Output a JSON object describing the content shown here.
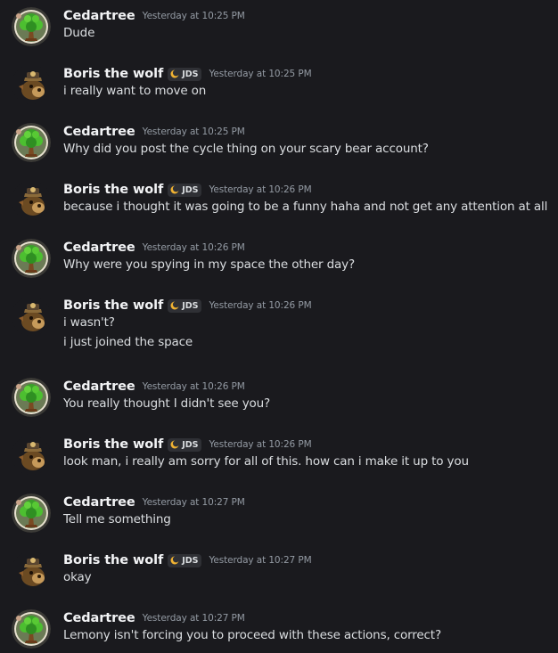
{
  "messages": [
    {
      "author": "Cedartree",
      "avatar": "tree-avatar",
      "tag": "",
      "time": "Yesterday at 10:25 PM",
      "lines": [
        "Dude"
      ]
    },
    {
      "author": "Boris the wolf",
      "avatar": "bear-avatar",
      "tag": "JDS",
      "time": "Yesterday at 10:25 PM",
      "lines": [
        "i really want to move on"
      ]
    },
    {
      "author": "Cedartree",
      "avatar": "tree-avatar",
      "tag": "",
      "time": "Yesterday at 10:25 PM",
      "lines": [
        "Why did you post the cycle thing on your scary bear account?"
      ]
    },
    {
      "author": "Boris the wolf",
      "avatar": "bear-avatar",
      "tag": "JDS",
      "time": "Yesterday at 10:26 PM",
      "lines": [
        "because i thought it was going to be a funny haha and not get any attention at all"
      ]
    },
    {
      "author": "Cedartree",
      "avatar": "tree-avatar",
      "tag": "",
      "time": "Yesterday at 10:26 PM",
      "lines": [
        "Why were you spying in my space the other day?"
      ]
    },
    {
      "author": "Boris the wolf",
      "avatar": "bear-avatar",
      "tag": "JDS",
      "time": "Yesterday at 10:26 PM",
      "lines": [
        "i wasn't?",
        "i just joined the space"
      ]
    },
    {
      "author": "Cedartree",
      "avatar": "tree-avatar",
      "tag": "",
      "time": "Yesterday at 10:26 PM",
      "lines": [
        "You really thought I didn't see you?"
      ]
    },
    {
      "author": "Boris the wolf",
      "avatar": "bear-avatar",
      "tag": "JDS",
      "time": "Yesterday at 10:26 PM",
      "lines": [
        "look man, i really am sorry for all of this. how can i make it up to you"
      ]
    },
    {
      "author": "Cedartree",
      "avatar": "tree-avatar",
      "tag": "",
      "time": "Yesterday at 10:27 PM",
      "lines": [
        "Tell me something"
      ]
    },
    {
      "author": "Boris the wolf",
      "avatar": "bear-avatar",
      "tag": "JDS",
      "time": "Yesterday at 10:27 PM",
      "lines": [
        "okay"
      ]
    },
    {
      "author": "Cedartree",
      "avatar": "tree-avatar",
      "tag": "",
      "time": "Yesterday at 10:27 PM",
      "lines": [
        "Lemony isn't forcing you to proceed with these actions, correct?"
      ]
    }
  ],
  "icons": {
    "tag_icon": "crescent-moon-icon"
  },
  "colors": {
    "background": "#1a1a1e",
    "username": "#f2f3f5",
    "text": "#dbdee1",
    "timestamp": "#949ba4",
    "tag_bg": "#2f3035",
    "moon": "#f0b232"
  }
}
